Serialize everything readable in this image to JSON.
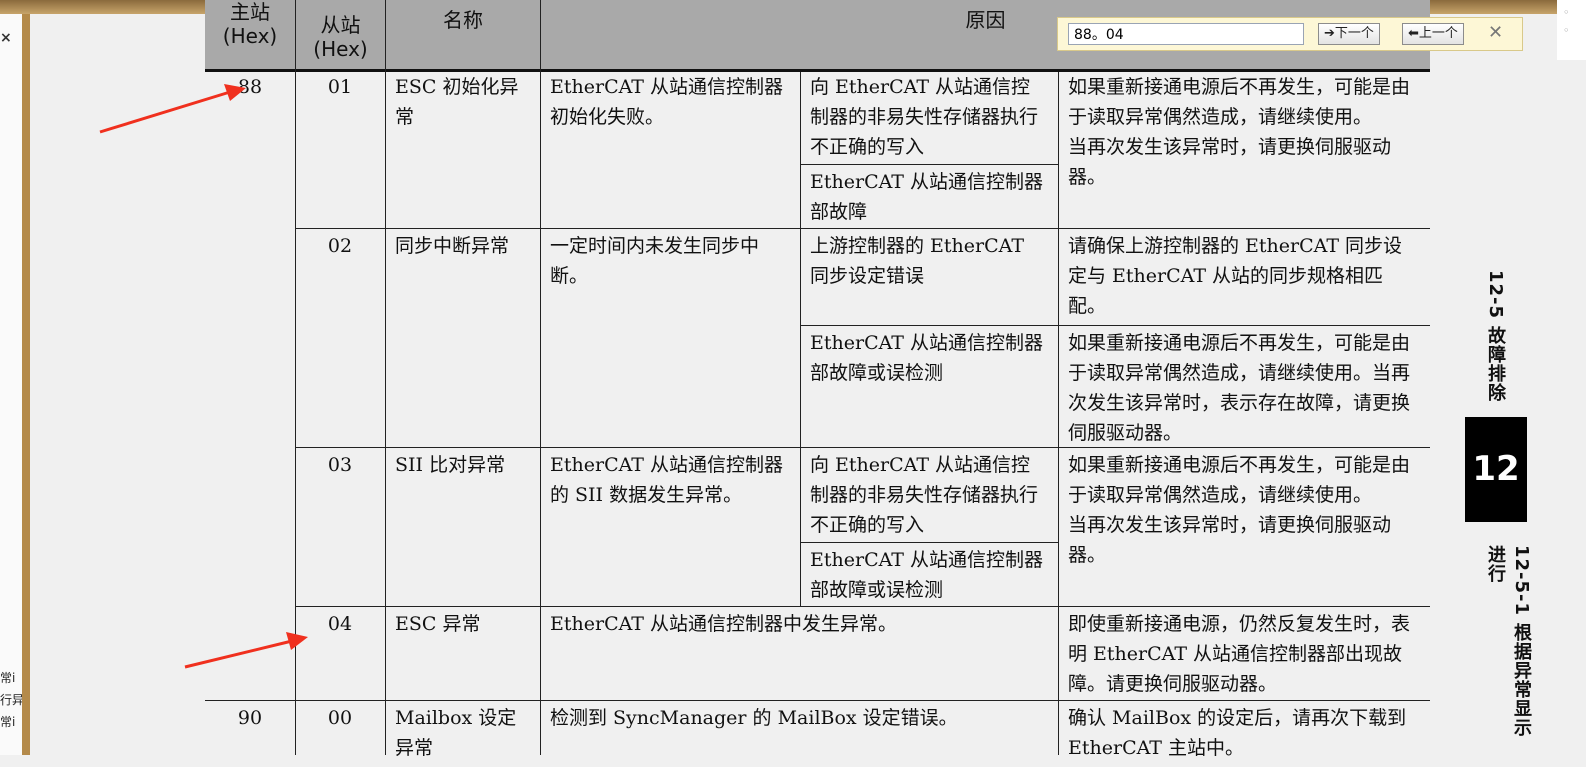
{
  "find": {
    "query": "88。04",
    "next_label": "下一个",
    "prev_label": "上一个",
    "close_label": "✕"
  },
  "left_pane": {
    "close_label": "×",
    "fragments": [
      "常i",
      "行异",
      "常i"
    ]
  },
  "table": {
    "headers": {
      "master": "主站\n(Hex)",
      "slave": "从站\n(Hex)",
      "name": "名称",
      "cause": "原因"
    },
    "cells": {
      "m88": "88",
      "s01": "01",
      "s02": "02",
      "s03": "03",
      "s04": "04",
      "m90": "90",
      "s00": "00",
      "n01": "ESC 初始化异常",
      "n02": "同步中断异常",
      "n03": "SII 比对异常",
      "n04": "ESC 异常",
      "n00": "Mailbox 设定异常",
      "c01": "EtherCAT 从站通信控制器初始化失败。",
      "c02": "一定时间内未发生同步中断。",
      "c03": "EtherCAT 从站通信控制器的 SII 数据发生异常。",
      "c04": "EtherCAT 从站通信控制器中发生异常。",
      "c00": "检测到 SyncManager 的 MailBox 设定错误。",
      "d01a": "向 EtherCAT 从站通信控制器的非易失性存储器执行不正确的写入",
      "d01b": "EtherCAT 从站通信控制器部故障",
      "d02a": "上游控制器的 EtherCAT 同步设定错误",
      "d02b": "EtherCAT 从站通信控制器部故障或误检测",
      "d03a": "向 EtherCAT 从站通信控制器的非易失性存储器执行不正确的写入",
      "d03b": "EtherCAT 从站通信控制器部故障或误检测",
      "r01": "如果重新接通电源后不再发生，可能是由于读取异常偶然造成，请继续使用。\n当再次发生该异常时，请更换伺服驱动器。",
      "r02a": "请确保上游控制器的 EtherCAT 同步设定与 EtherCAT 从站的同步规格相匹配。",
      "r02b": "如果重新接通电源后不再发生，可能是由于读取异常偶然造成，请继续使用。当再次发生该异常时，表示存在故障，请更换伺服驱动器。",
      "r03": "如果重新接通电源后不再发生，可能是由于读取异常偶然造成，请继续使用。\n当再次发生该异常时，请更换伺服驱动器。",
      "r04": "即使重新接通电源，仍然反复发生时，表明 EtherCAT 从站通信控制器部出现故障。请更换伺服驱动器。",
      "r00": "确认 MailBox 的设定后，请再次下载到 EtherCAT 主站中。"
    }
  },
  "margin": {
    "section": "12-5  故障排除",
    "chapter": "12",
    "subsection": "12-5-1  根据异常显示进行"
  },
  "colors": {
    "header_bg": "#a9a9a9",
    "page_bg": "#f0f0f0",
    "arrow": "#f0301e",
    "findbar_bg": "#fdf7d6"
  }
}
